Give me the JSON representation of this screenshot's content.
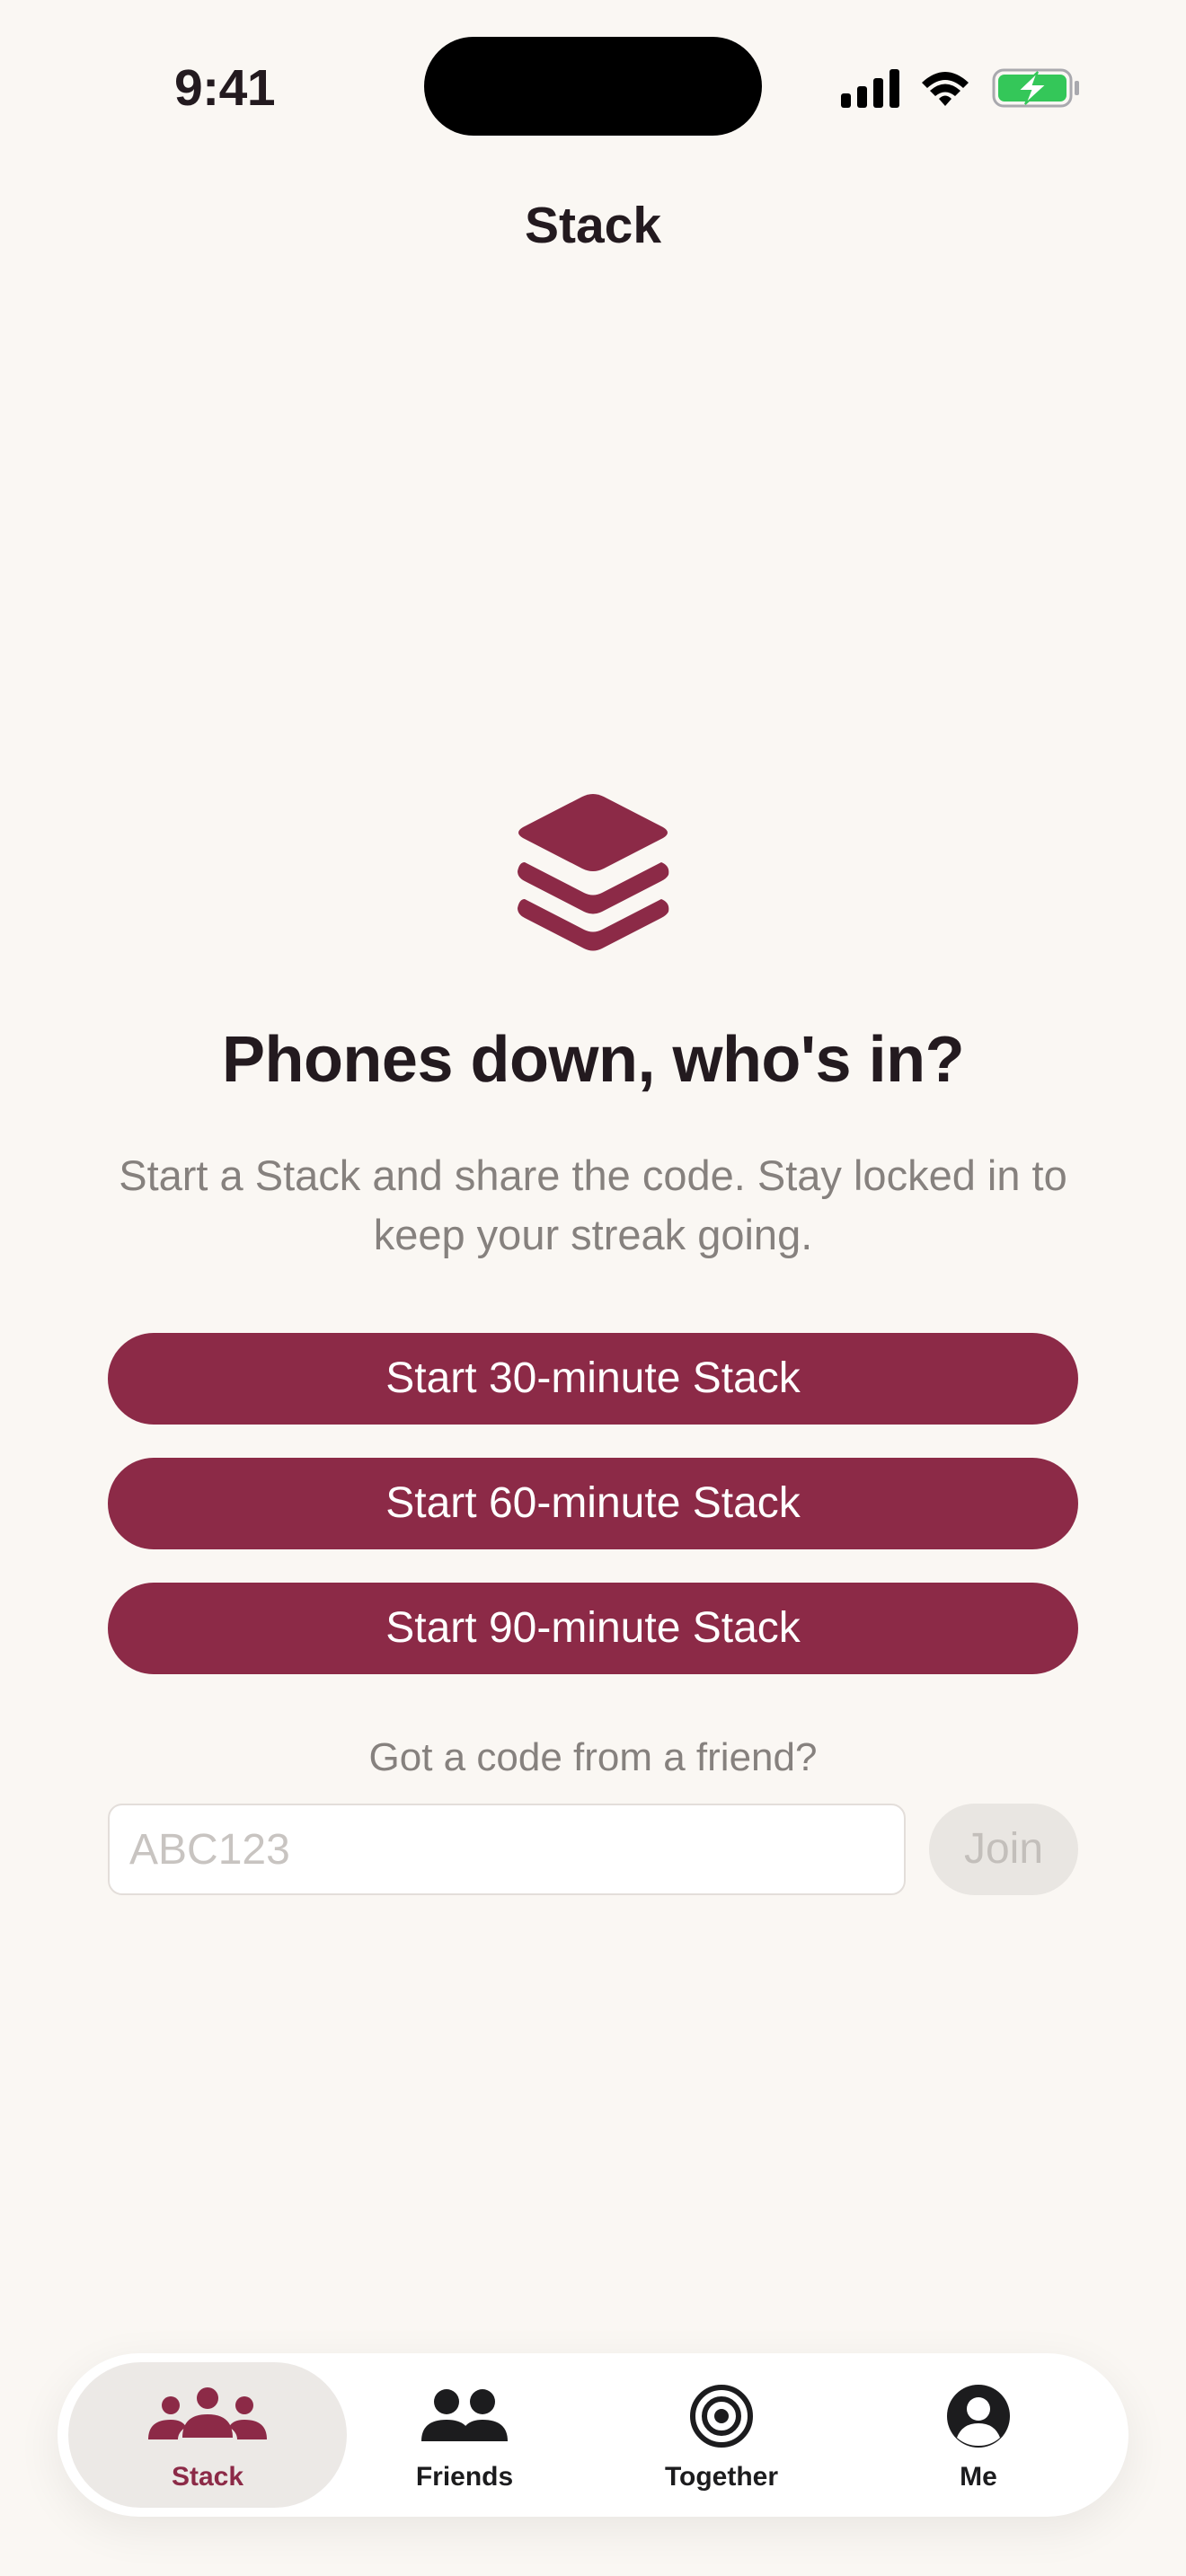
{
  "status_bar": {
    "time": "9:41",
    "icons": [
      "cellular-signal-icon",
      "wifi-icon",
      "battery-charging-icon"
    ],
    "battery_color": "#34C759"
  },
  "nav": {
    "title": "Stack"
  },
  "hero": {
    "icon": "stack-layers-icon",
    "headline": "Phones down, who's in?",
    "subtitle": "Start a Stack and share the code. Stay locked in to keep your streak going."
  },
  "actions": {
    "start_buttons": [
      {
        "label": "Start 30-minute Stack"
      },
      {
        "label": "Start 60-minute Stack"
      },
      {
        "label": "Start 90-minute Stack"
      }
    ]
  },
  "join": {
    "prompt": "Got a code from a friend?",
    "input_value": "",
    "input_placeholder": "ABC123",
    "button_label": "Join"
  },
  "tab_bar": {
    "tabs": [
      {
        "label": "Stack",
        "icon": "group-icon",
        "selected": true
      },
      {
        "label": "Friends",
        "icon": "two-people-icon",
        "selected": false
      },
      {
        "label": "Together",
        "icon": "target-icon",
        "selected": false
      },
      {
        "label": "Me",
        "icon": "profile-icon",
        "selected": false
      }
    ]
  },
  "colors": {
    "accent": "#8C2A47",
    "background": "#FAF7F3",
    "text_primary": "#231A1F",
    "text_secondary": "#86817E"
  }
}
